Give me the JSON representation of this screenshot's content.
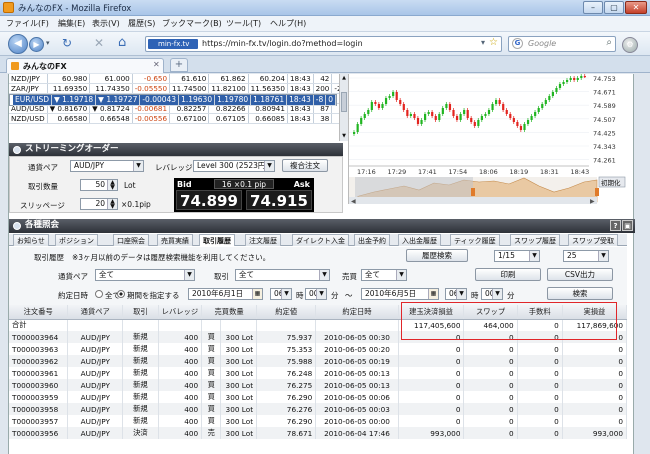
{
  "window": {
    "title": "みんなのFX - Mozilla Firefox"
  },
  "menu": [
    "ファイル(F)",
    "編集(E)",
    "表示(V)",
    "履歴(S)",
    "ブックマーク(B)",
    "ツール(T)",
    "ヘルプ(H)"
  ],
  "nav": {
    "site_label": "min-fx.tv",
    "url": "https://min-fx.tv/login.do?method=login",
    "search_placeholder": "Google"
  },
  "browser_tab": {
    "label": "みんなのFX",
    "new_tab": "+"
  },
  "rates": [
    {
      "pair": "NZD/JPY",
      "c1": "60.980",
      "c2": "61.000",
      "c3": "-0.650",
      "c4": "61.610",
      "c5": "61.862",
      "c6": "60.204",
      "c7": "18:43",
      "c8": "42",
      "c9": "-53"
    },
    {
      "pair": "ZAR/JPY",
      "c1": "11.69350",
      "c2": "11.74350",
      "c3": "-0.05550",
      "c4": "11.74500",
      "c5": "11.82100",
      "c6": "11.56350",
      "c7": "18:43",
      "c8": "200",
      "c9": "-250"
    },
    {
      "pair": "EUR/USD",
      "c1": "▼ 1.19718",
      "c2": "▼ 1.19727",
      "c3": "-0.00043",
      "c4": "1.19630",
      "c5": "1.19780",
      "c6": "1.18761",
      "c7": "18:43",
      "c8": "-8",
      "c9": "0",
      "selected": true
    },
    {
      "pair": "GBP/USD",
      "c1": "▼ 1.44398",
      "c2": "▼ 1.44443",
      "c3": "-0.00194",
      "c4": "1.44182",
      "c5": "1.44599",
      "c6": "1.43861",
      "c7": "18:43",
      "c8": "1",
      "c9": "-12"
    },
    {
      "pair": "AUD/USD",
      "c1": "▼ 0.81670",
      "c2": "▼ 0.81724",
      "c3": "-0.00681",
      "c4": "0.82257",
      "c5": "0.82266",
      "c6": "0.80941",
      "c7": "18:43",
      "c8": "87",
      "c9": "-96"
    },
    {
      "pair": "NZD/USD",
      "c1": "0.66580",
      "c2": "0.66548",
      "c3": "-0.00556",
      "c4": "0.67100",
      "c5": "0.67105",
      "c6": "0.66085",
      "c7": "18:43",
      "c8": "38",
      "c9": "-47"
    }
  ],
  "chart": {
    "y_ticks": [
      "74.753",
      "74.671",
      "74.589",
      "74.507",
      "74.425",
      "74.343",
      "74.261"
    ],
    "x_ticks": [
      "17:16",
      "17:29",
      "17:41",
      "17:54",
      "18:06",
      "18:19",
      "18:31",
      "18:43"
    ],
    "init_button": "初期化"
  },
  "streaming": {
    "title": "ストリーミングオーダー",
    "pair_label": "通貨ペア",
    "pair_value": "AUD/JPY",
    "leverage_label": "レバレッジ",
    "leverage_value": "Level 300 (2523円)",
    "compound_button": "複合注文",
    "qty_label": "取引数量",
    "qty_value": "50",
    "qty_unit": "Lot",
    "slip_label": "スリッページ",
    "slip_value": "20",
    "slip_unit": "×0.1pip",
    "bid_label": "Bid",
    "ask_label": "Ask",
    "spread": "16 ×0.1 pip",
    "bid": "74.899",
    "ask": "74.915"
  },
  "history": {
    "title": "各種照会",
    "tabs": [
      "お知らせ",
      "ポジション",
      "口座照会",
      "売買実績",
      "取引履歴",
      "注文履歴",
      "ダイレクト入金",
      "出金予約",
      "入出金履歴",
      "ティック履歴",
      "スワップ履歴",
      "スワップ受取"
    ],
    "active_tab": 4,
    "note_label": "取引履歴",
    "note": "※3ヶ月以前のデータは履歴検索機能を利用してください。",
    "history_search_button": "履歴検索",
    "page_value": "1/15",
    "per_page_value": "25",
    "pair_label": "通貨ペア",
    "pair_value": "全て",
    "trade_label": "取引",
    "trade_value": "全て",
    "side_label": "売買",
    "side_value": "全て",
    "print_button": "印刷",
    "csv_button": "CSV出力",
    "date_label": "約定日時",
    "radio_all": "全て",
    "radio_range": "期間を指定する",
    "date_from": "2010年6月1日",
    "hour_from": "06",
    "hour_unit": "時",
    "min_from": "00",
    "min_unit": "分",
    "range_sep": "～",
    "date_to": "2010年6月5日",
    "hour_to": "06",
    "min_to": "00",
    "search_button": "検索"
  },
  "table": {
    "headers": [
      "注文番号",
      "通貨ペア",
      "取引",
      "レバレッジ",
      "売買数量",
      "約定値",
      "約定日時",
      "建玉決済損益",
      "スワップ",
      "手数料",
      "実損益"
    ],
    "total": {
      "label": "合計",
      "pl": "117,405,600",
      "swap": "464,000",
      "fee": "0",
      "real": "117,869,600"
    },
    "rows": [
      [
        "T000003964",
        "AUD/JPY",
        "新規",
        "400",
        "買",
        "300 Lot",
        "75.937",
        "2010-06-05 00:30",
        "0",
        "0",
        "0",
        "0"
      ],
      [
        "T000003963",
        "AUD/JPY",
        "新規",
        "400",
        "買",
        "300 Lot",
        "75.353",
        "2010-06-05 00:20",
        "0",
        "0",
        "0",
        "0"
      ],
      [
        "T000003962",
        "AUD/JPY",
        "新規",
        "400",
        "買",
        "300 Lot",
        "75.988",
        "2010-06-05 00:19",
        "0",
        "0",
        "0",
        "0"
      ],
      [
        "T000003961",
        "AUD/JPY",
        "新規",
        "400",
        "買",
        "300 Lot",
        "76.248",
        "2010-06-05 00:13",
        "0",
        "0",
        "0",
        "0"
      ],
      [
        "T000003960",
        "AUD/JPY",
        "新規",
        "400",
        "買",
        "300 Lot",
        "76.275",
        "2010-06-05 00:13",
        "0",
        "0",
        "0",
        "0"
      ],
      [
        "T000003959",
        "AUD/JPY",
        "新規",
        "400",
        "買",
        "300 Lot",
        "76.290",
        "2010-06-05 00:06",
        "0",
        "0",
        "0",
        "0"
      ],
      [
        "T000003958",
        "AUD/JPY",
        "新規",
        "400",
        "買",
        "300 Lot",
        "76.276",
        "2010-06-05 00:03",
        "0",
        "0",
        "0",
        "0"
      ],
      [
        "T000003957",
        "AUD/JPY",
        "新規",
        "400",
        "買",
        "300 Lot",
        "76.290",
        "2010-06-05 00:00",
        "0",
        "0",
        "0",
        "0"
      ],
      [
        "T000003956",
        "AUD/JPY",
        "決済",
        "400",
        "売",
        "300 Lot",
        "78.671",
        "2010-06-04 17:46",
        "993,000",
        "0",
        "0",
        "993,000"
      ]
    ]
  },
  "colors": {
    "up_candle": "#21b521",
    "down_candle": "#e3241f",
    "header_dark": "#3a3f47",
    "highlight_box": "#e0262a"
  }
}
